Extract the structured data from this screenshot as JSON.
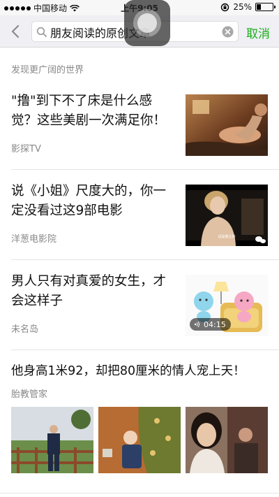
{
  "status_bar": {
    "carrier": "中国移动",
    "time": "上午9:05",
    "battery_percent": "25%",
    "battery_level": 0.25
  },
  "search": {
    "value": "朋友阅读的原创文章",
    "cancel_label": "取消"
  },
  "section": {
    "title": "发现更广阔的世界"
  },
  "articles": [
    {
      "title_line1": "\"撸\"到下不了床是什么感",
      "title_line2": "觉？这些美剧一次满足你！",
      "source": "影探TV"
    },
    {
      "title_line1": "说《小姐》尺度大的，你一",
      "title_line2": "定没看过这9部电影",
      "source": "洋葱电影院",
      "subtitle_text": "这是做主的"
    },
    {
      "title_line1": "男人只有对真爱的女生，才",
      "title_line2": "会这样子",
      "source": "未名岛",
      "duration": "04:15"
    },
    {
      "title": "他身高1米92，却把80厘米的情人宠上天！",
      "source": "胎教管家"
    }
  ],
  "colors": {
    "accent": "#1aad19",
    "secondary_text": "#888888",
    "header_bg": "#efeff4"
  },
  "icons": [
    "signal-icon",
    "wifi-icon",
    "lock-rotation-icon",
    "battery-icon",
    "back-icon",
    "search-icon",
    "clear-icon",
    "audio-icon"
  ]
}
